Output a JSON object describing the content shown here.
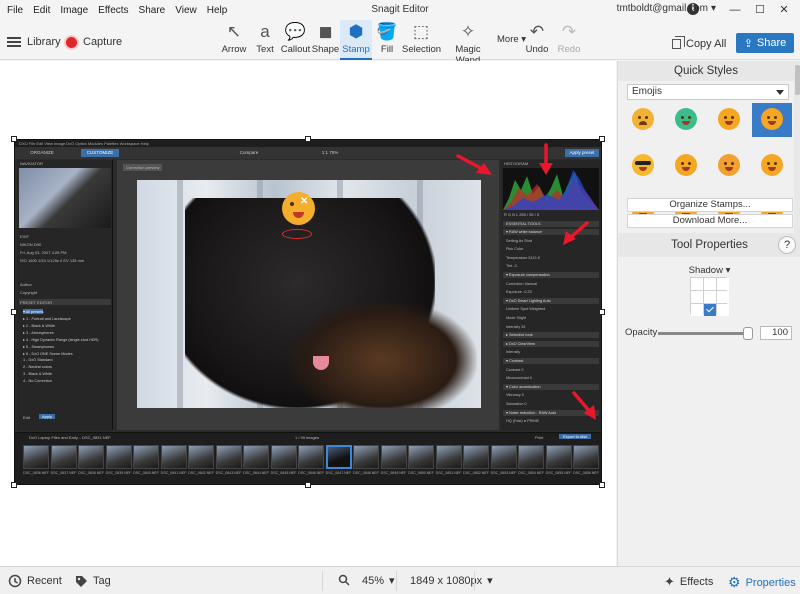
{
  "menu": [
    "File",
    "Edit",
    "Image",
    "Effects",
    "Share",
    "View",
    "Help"
  ],
  "app_title": "Snagit Editor",
  "account": {
    "email": "tmtboldt@gmail.com",
    "caret": "▾",
    "info_glyph": "i"
  },
  "window": {
    "minimize": "—",
    "maximize": "☐",
    "close": "✕"
  },
  "toolbar": {
    "library_label": "Library",
    "capture_label": "Capture",
    "tools": [
      {
        "label": "Arrow",
        "glyph": "↖"
      },
      {
        "label": "Text",
        "glyph": "a"
      },
      {
        "label": "Callout",
        "glyph": "💬"
      },
      {
        "label": "Shape",
        "glyph": "◼"
      },
      {
        "label": "Stamp",
        "glyph": "⬢"
      },
      {
        "label": "Fill",
        "glyph": "🪣"
      },
      {
        "label": "Selection",
        "glyph": "⬚"
      },
      {
        "label": "Magic Wand",
        "glyph": "✧"
      },
      {
        "label": "Undo",
        "glyph": "↶"
      },
      {
        "label": "Redo",
        "glyph": "↷"
      }
    ],
    "more_label": "More",
    "more_caret": "▾",
    "copy_all_label": "Copy All",
    "share_label": "Share",
    "share_glyph": "⇪",
    "active_tool": "Stamp",
    "accent_color": "#2b78c2"
  },
  "canvas": {
    "app_menu": "DXO   File   Edit   View   Image   DxO Optics Modules   Palettes   Workspace   Help",
    "app_tabs": [
      "ORGANIZE",
      "CUSTOMIZE"
    ],
    "compare_label": "Compare",
    "zoom_label": "1:1   75%",
    "export_label": "Apply preset",
    "left_panel": {
      "navigator": "NAVIGATOR",
      "exif": [
        "EXIF",
        "NIKON D90",
        "Fri, Aug 03, 2007 4:28 PM",
        "ISO 1600   1/54   1/125s   0 EV   135 mm"
      ],
      "author": "Author",
      "copyright": "Copyright",
      "preset_editor": "PRESET EDITOR",
      "presets": [
        "▾ All presets",
        "  ▸ 1 - Portrait and Landscape",
        "  ▸ 2 - Black & White",
        "  ▸ 3 - Atmospheres",
        "  ▸ 4 - High Dynamic Range (single-shot HDR)",
        "  ▸ 5 - Smartphones",
        "  ▸ 6 - DxO ONE Scene Modes",
        "    1 - DxO Standard",
        "    2 - Neutral colors",
        "    3 - Black & White",
        "    4 - No Correction"
      ],
      "edit_btn": "Edit",
      "apply_btn": "Apply"
    },
    "correction_preview": "Correction preview",
    "right_panel": {
      "histogram": "HISTOGRAM",
      "histogram_values": "R  G  B   L   255 / 55 / 0",
      "essential_tools": "ESSENTIAL TOOLS",
      "lines": [
        {
          "text": "▾ RAW white balance",
          "head": true
        },
        {
          "text": "Setting      As Shot",
          "head": false
        },
        {
          "text": "Pick Color",
          "head": false
        },
        {
          "text": "Temperature                    5113 K",
          "head": false
        },
        {
          "text": "Tint                                   -3",
          "head": false
        },
        {
          "text": "▾ Exposure compensation",
          "head": true
        },
        {
          "text": "Correction    Manual",
          "head": false
        },
        {
          "text": "Exposure                          -0.33",
          "head": false
        },
        {
          "text": "▾ DxO Smart Lighting        Auto",
          "head": true
        },
        {
          "text": "    Uniform    Spot Weighted",
          "head": false
        },
        {
          "text": "Mode      Slight",
          "head": false
        },
        {
          "text": "Intensity                            25",
          "head": false
        },
        {
          "text": "▸ Selective tone",
          "head": true
        },
        {
          "text": "▸ DxO ClearView",
          "head": true
        },
        {
          "text": "Intensity",
          "head": false
        },
        {
          "text": "▾ Contrast",
          "head": true
        },
        {
          "text": "Contrast                              0",
          "head": false
        },
        {
          "text": "Microcontrast                       0",
          "head": false
        },
        {
          "text": "▾ Color accentuation",
          "head": true
        },
        {
          "text": "Vibrancy                             0",
          "head": false
        },
        {
          "text": "Saturation                          0",
          "head": false
        },
        {
          "text": "▾ Noise reduction - RAW    Auto",
          "head": true
        },
        {
          "text": "HQ (Fast)        ● PRIME",
          "head": false
        }
      ]
    },
    "filmstrip": {
      "folder": "DxO Laptop Files and Early...   DSC_0831.NEF",
      "counter": "1 / 99 images",
      "print_label": "Print",
      "export_label": "Export to disk",
      "thumbs": [
        "DSC_0836.NEF",
        "DSC_0837.NEF",
        "DSC_0838.NEF",
        "DSC_0839.NEF",
        "DSC_0840.NEF",
        "DSC_0841.NEF",
        "DSC_0842.NEF",
        "DSC_0843.NEF",
        "DSC_0844.NEF",
        "DSC_0845.NEF",
        "DSC_0846.NEF",
        "DSC_0847.NEF",
        "DSC_0848.NEF",
        "DSC_0849.NEF",
        "DSC_0850.NEF",
        "DSC_0851.NEF",
        "DSC_0852.NEF",
        "DSC_0853.NEF",
        "DSC_0854.NEF",
        "DSC_0855.NEF",
        "DSC_0856.NEF"
      ],
      "selected_index": 11
    }
  },
  "quick_styles": {
    "title": "Quick Styles",
    "category": "Emojis",
    "emojis": [
      {
        "name": "crying-emoji",
        "color": "#f2b233",
        "variant": "sad"
      },
      {
        "name": "green-emoji",
        "color": "#3cbc8a",
        "variant": "mouth"
      },
      {
        "name": "big-smile-emoji",
        "color": "#f5a623",
        "variant": "mouth"
      },
      {
        "name": "shocked-emoji",
        "color": "#f5a623",
        "variant": "mouth"
      },
      {
        "name": "sunglasses-emoji",
        "color": "#f5b82e",
        "variant": "shades"
      },
      {
        "name": "tongue-emoji",
        "color": "#f5a623",
        "variant": "mouth"
      },
      {
        "name": "headband-emoji",
        "color": "#f4a030",
        "variant": "mouth"
      },
      {
        "name": "blush-emoji",
        "color": "#f5a623",
        "variant": "mouth"
      },
      {
        "name": "partial-emoji-1",
        "color": "#f5a623",
        "variant": "mouth"
      },
      {
        "name": "partial-emoji-2",
        "color": "#f5a623",
        "variant": "mouth"
      },
      {
        "name": "partial-emoji-3",
        "color": "#f5a623",
        "variant": "mouth"
      },
      {
        "name": "partial-emoji-4",
        "color": "#f5a623",
        "variant": "mouth"
      }
    ],
    "selected_index": 3,
    "organize_label": "Organize Stamps...",
    "download_label": "Download More..."
  },
  "tool_properties": {
    "title": "Tool Properties",
    "help": "?",
    "shadow_label": "Shadow",
    "shadow_caret": "▾",
    "shadow_selected": 7,
    "opacity_label": "Opacity",
    "opacity_value": "100",
    "opacity_fraction": 1.0
  },
  "statusbar": {
    "recent": "Recent",
    "tag": "Tag",
    "zoom": "45%",
    "zoom_caret": "▾",
    "dimensions": "1849 x 1080px",
    "dimensions_caret": "▾",
    "effects": "Effects",
    "properties": "Properties"
  }
}
